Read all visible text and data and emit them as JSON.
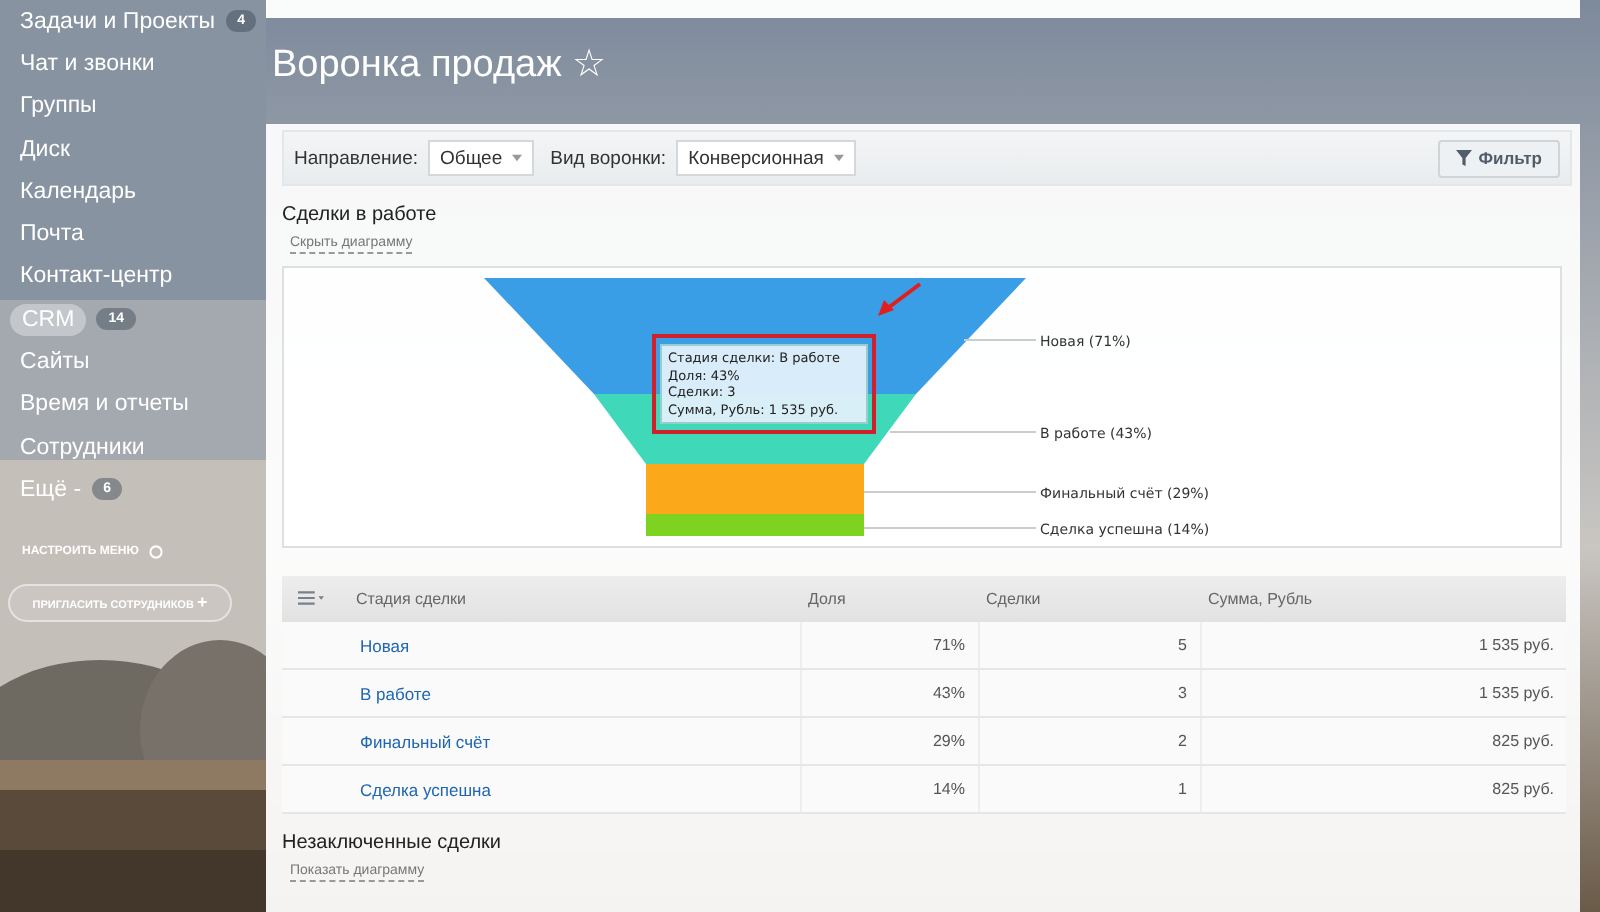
{
  "sidebar": {
    "items": [
      {
        "label": "Задачи и Проекты",
        "badge": "4",
        "selected": false
      },
      {
        "label": "Чат и звонки",
        "selected": false
      },
      {
        "label": "Группы",
        "selected": false
      },
      {
        "label": "Диск",
        "selected": false
      },
      {
        "label": "Календарь",
        "selected": false
      },
      {
        "label": "Почта",
        "selected": false
      },
      {
        "label": "Контакт-центр",
        "selected": false
      },
      {
        "label": "CRM",
        "badge": "14",
        "selected": true
      },
      {
        "label": "Сайты",
        "selected": false
      },
      {
        "label": "Время и отчеты",
        "selected": false
      },
      {
        "label": "Сотрудники",
        "selected": false
      },
      {
        "label": "Ещё -",
        "badge": "6",
        "selected": false
      }
    ],
    "settings": "НАСТРОИТЬ МЕНЮ",
    "invite": "ПРИГЛАСИТЬ СОТРУДНИКОВ",
    "invite_icon": "+"
  },
  "page_title": "Воронка продаж ☆",
  "toolbar": {
    "filters": [
      {
        "label": "Направление:",
        "value": "Общее"
      },
      {
        "label": "Вид воронки:",
        "value": "Конверсионная"
      }
    ],
    "filter_button": "Фильтр"
  },
  "in_progress": {
    "title": "Сделки в работе",
    "toggle": "Скрыть диаграмму",
    "funnel": {
      "segments": [
        {
          "label": "Новая (71%)",
          "color": "#3a9ee6"
        },
        {
          "label": "В работе (43%)",
          "color": "#3fd9b9"
        },
        {
          "label": "Финальный счёт (29%)",
          "color": "#fba91a"
        },
        {
          "label": "Сделка успешна (14%)",
          "color": "#7ed321"
        }
      ],
      "tooltip": [
        "Стадия сделки: В работе",
        "Доля: 43%",
        "Сделки: 3",
        "Сумма, Рубль: 1 535 руб."
      ]
    },
    "table": {
      "columns": [
        "Стадия сделки",
        "Доля",
        "Сделки",
        "Сумма, Рубль"
      ],
      "rows": [
        [
          "Новая",
          "71%",
          "5",
          "1 535 руб."
        ],
        [
          "В работе",
          "43%",
          "3",
          "1 535 руб."
        ],
        [
          "Финальный счёт",
          "29%",
          "2",
          "825 руб."
        ],
        [
          "Сделка успешна",
          "14%",
          "1",
          "825 руб."
        ]
      ]
    }
  },
  "not_closed": {
    "title": "Незаключенные сделки",
    "toggle": "Показать диаграмму"
  }
}
